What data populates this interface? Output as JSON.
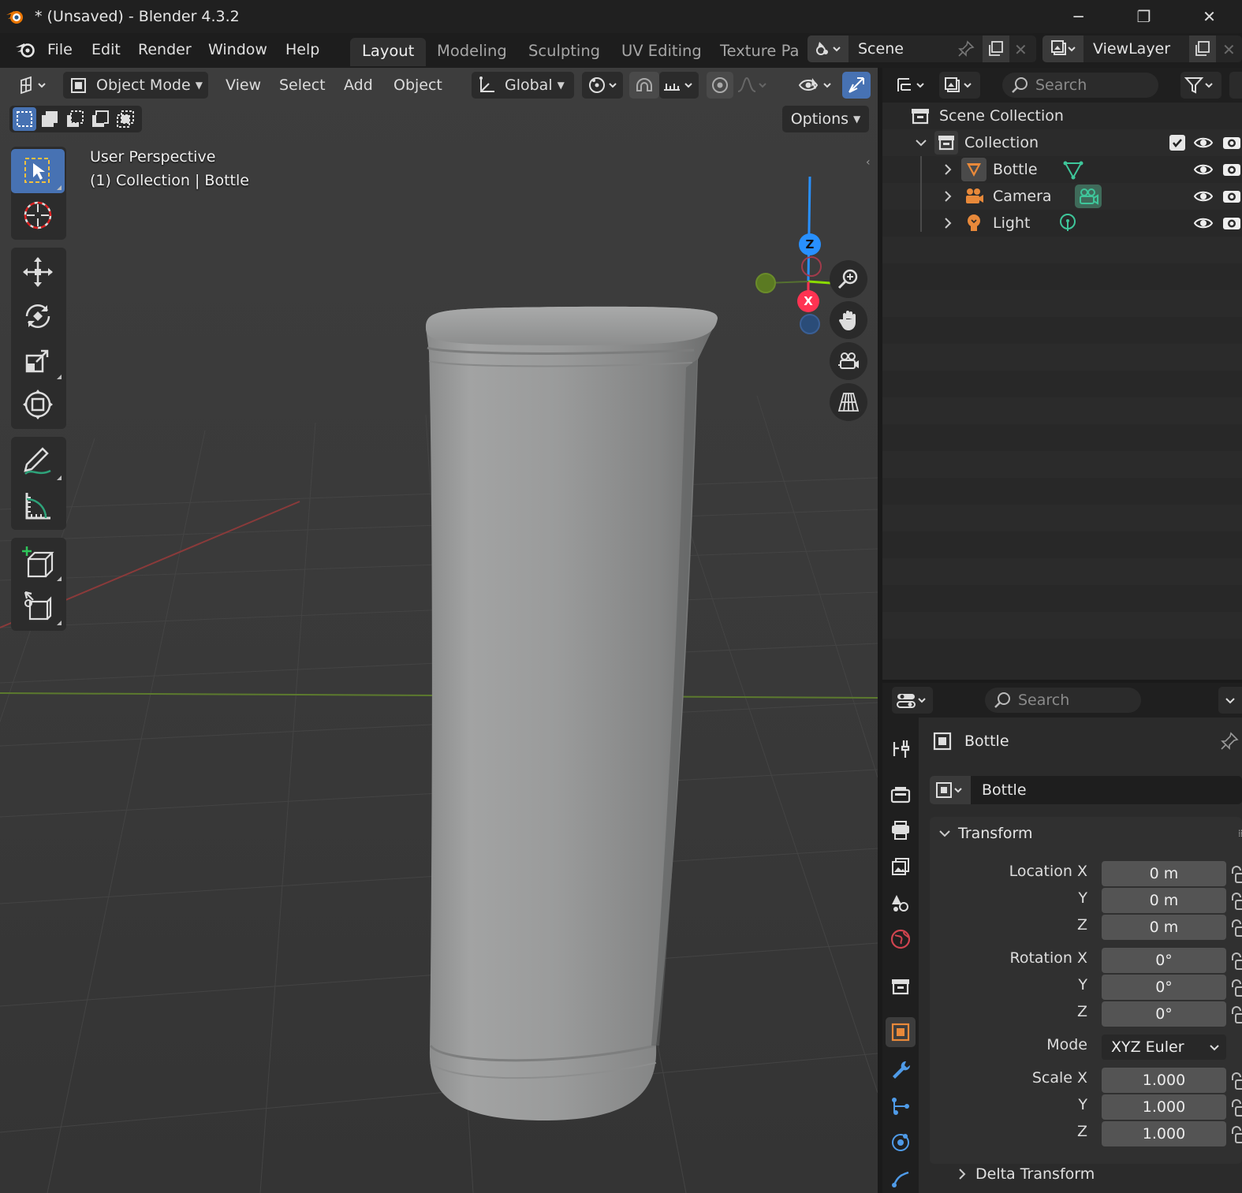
{
  "window": {
    "title": "* (Unsaved) - Blender 4.3.2",
    "minimize_label": "─",
    "maximize_label": "❐",
    "close_label": "✕"
  },
  "menu": {
    "items": [
      "File",
      "Edit",
      "Render",
      "Window",
      "Help"
    ]
  },
  "workspaces": {
    "tabs": [
      "Layout",
      "Modeling",
      "Sculpting",
      "UV Editing",
      "Texture Pa"
    ],
    "active": "Layout"
  },
  "scene": {
    "name": "Scene"
  },
  "view_layer": {
    "name": "ViewLayer"
  },
  "viewport_header": {
    "mode": "Object Mode",
    "menus": [
      "View",
      "Select",
      "Add",
      "Object"
    ],
    "orientation": "Global",
    "options_label": "Options"
  },
  "viewport": {
    "perspective_label": "User Perspective",
    "collection_label": "(1) Collection | Bottle",
    "gizmo_axes": {
      "x": "X",
      "y": "Y",
      "z": "Z"
    }
  },
  "outliner": {
    "search_placeholder": "Search",
    "scene_collection": "Scene Collection",
    "collection": "Collection",
    "objects": [
      {
        "name": "Bottle",
        "type_icon": "mesh-data-icon"
      },
      {
        "name": "Camera",
        "type_icon": "camera-data-icon"
      },
      {
        "name": "Light",
        "type_icon": "light-data-icon"
      }
    ]
  },
  "properties": {
    "search_placeholder": "Search",
    "object_name": "Bottle",
    "datablock_name": "Bottle",
    "panel_transform": "Transform",
    "panel_delta": "Delta Transform",
    "location": {
      "label": "Location X",
      "x": "0 m",
      "y": "0 m",
      "z": "0 m"
    },
    "rotation": {
      "label": "Rotation X",
      "x": "0°",
      "y": "0°",
      "z": "0°"
    },
    "mode": {
      "label": "Mode",
      "value": "XYZ Euler"
    },
    "scale": {
      "label": "Scale X",
      "x": "1.000",
      "y": "1.000",
      "z": "1.000"
    },
    "axis_y": "Y",
    "axis_z": "Z"
  },
  "colors": {
    "accent": "#4772b3",
    "axis_x": "#ff3352",
    "axis_y": "#8bdc00",
    "axis_z": "#2890ff",
    "object_orange": "#e8893a",
    "data_green": "#3ec69a"
  }
}
